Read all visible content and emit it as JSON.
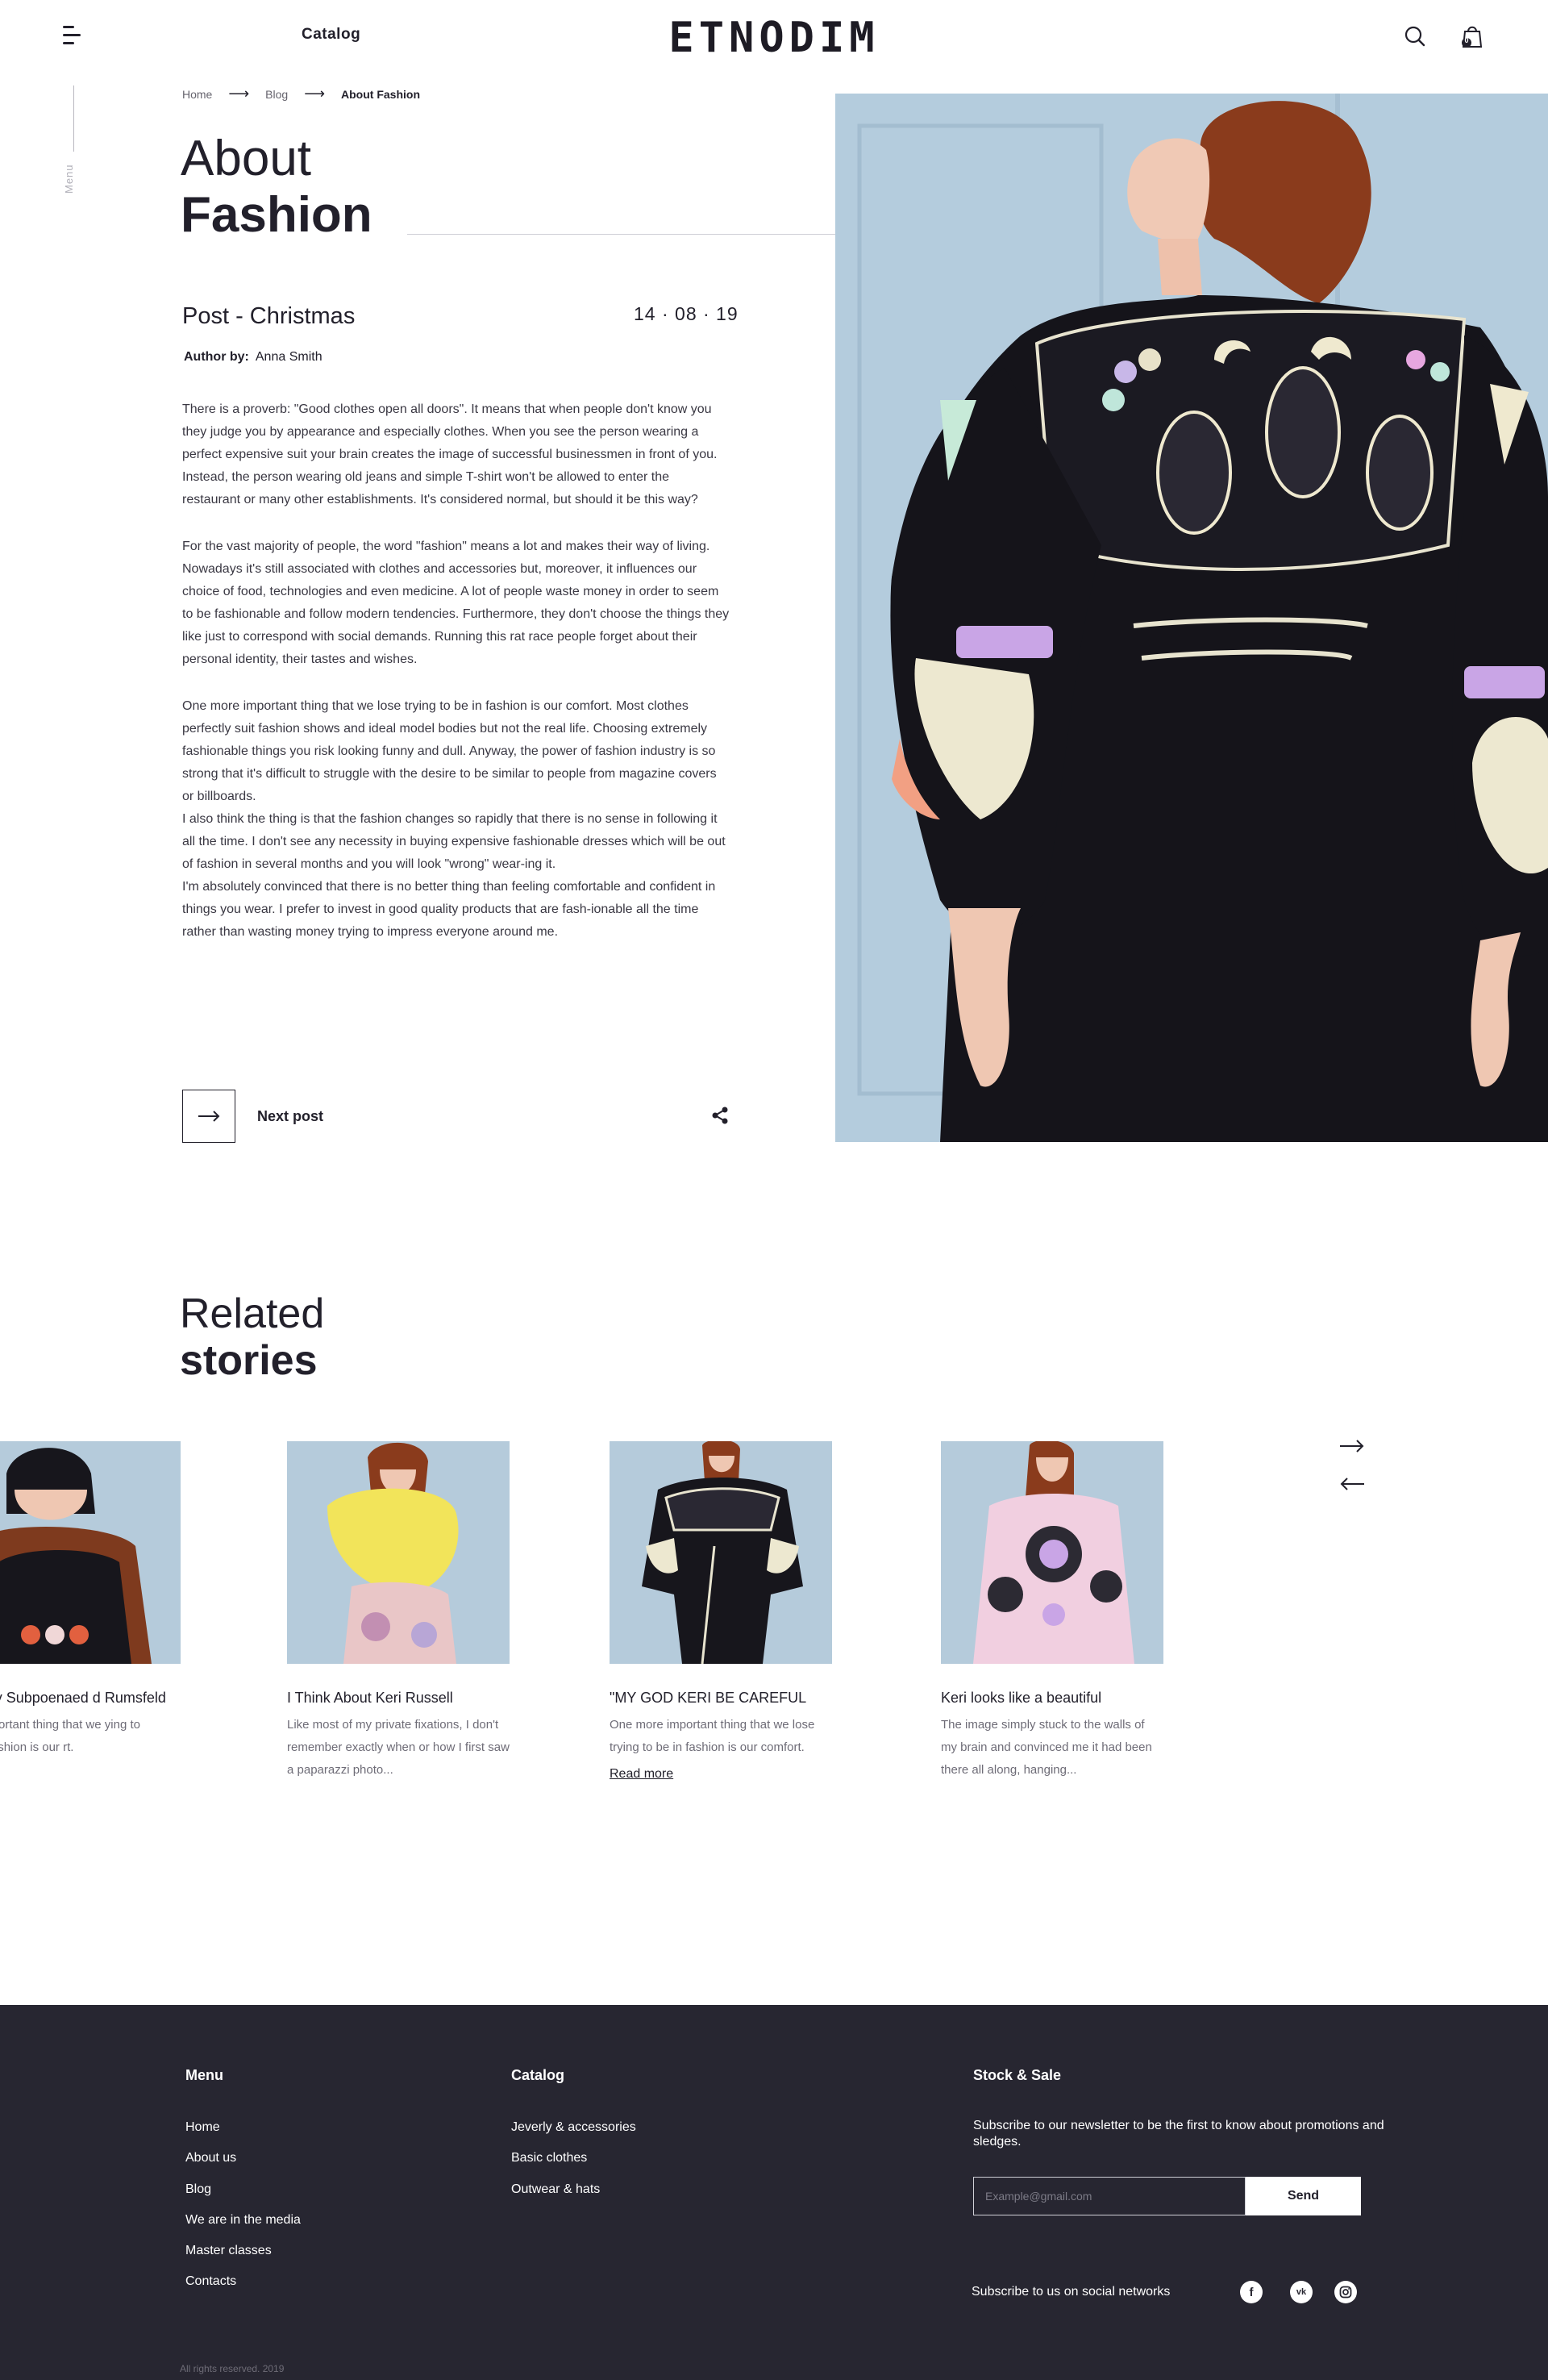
{
  "header": {
    "catalog_label": "Catalog",
    "logo_text": "ETNODIM",
    "cart_count": "0"
  },
  "side": {
    "menu_label": "Menu"
  },
  "breadcrumb": [
    "Home",
    "Blog",
    "About Fashion"
  ],
  "article": {
    "title_line1": "About",
    "title_line2": "Fashion",
    "post_tag": "Post - Christmas",
    "date": "14 · 08 · 19",
    "author_label": "Author by:",
    "author_name": "Anna Smith",
    "paragraphs": [
      "There is a proverb: \"Good clothes open all doors\". It means that when people don't know you they judge you by appearance and especially clothes. When you see the person wearing a perfect expensive suit your brain creates the image of successful businessmen in front of you. Instead, the person wearing old jeans and simple T-shirt won't be allowed to enter the restaurant or many other establishments. It's considered normal, but should it be this way?",
      "For the vast majority of people, the word \"fashion\" means a lot and makes their way of living. Nowadays it's still associated with clothes and accessories but, moreover, it influences our choice of food, technologies and even medicine. A lot of people waste money in order to seem to be fashionable and follow modern tendencies. Furthermore, they don't choose the things they like just to correspond with social demands. Running this rat race people forget about their personal identity, their tastes and wishes.",
      "One more important thing that we lose trying to be in fashion is our comfort. Most clothes perfectly suit fashion shows and ideal model bodies but not the real life. Choosing extremely fashionable things you risk looking funny and dull. Anyway, the power of fashion industry is so strong that it's difficult to struggle with the desire to be similar to people from magazine covers or billboards.",
      "I also think the thing is that the fashion changes so rapidly that there is no sense in following it all the time. I don't see any necessity in buying expensive fashionable dresses which will be out of fashion in several months and you will look \"wrong\" wear-ing it.",
      "I'm absolutely convinced that there is no better thing than feeling comfortable and confident in things you wear. I prefer to invest in good quality products that are fash-ionable all the time rather than wasting money trying to impress everyone around me."
    ],
    "next_post_label": "Next post"
  },
  "related": {
    "title_line1": "Related",
    "title_line2": "stories",
    "stories": [
      {
        "title": "e They Subpoenaed d Rumsfeld",
        "excerpt": "ore important thing that we ying to be in fashion is our rt.",
        "read_more": ""
      },
      {
        "title": "I Think About Keri Russell",
        "excerpt": "Like most of my private fixations, I don't remember exactly when or how I first saw a paparazzi photo...",
        "read_more": ""
      },
      {
        "title": "\"MY GOD KERI BE CAREFUL",
        "excerpt": "One more important thing that we lose trying to be in fashion is our comfort.",
        "read_more": "Read more"
      },
      {
        "title": "Keri looks like a beautiful",
        "excerpt": "The image simply stuck to the walls of my brain and convinced me it had been there all along, hanging...",
        "read_more": ""
      }
    ]
  },
  "footer": {
    "menu_title": "Menu",
    "menu_items": [
      "Home",
      "About us",
      "Blog",
      "We are in the media",
      "Master classes",
      "Contacts"
    ],
    "catalog_title": "Catalog",
    "catalog_items": [
      "Jeverly & accessories",
      "Basic clothes",
      "Outwear & hats"
    ],
    "stock_title": "Stock & Sale",
    "newsletter_text": "Subscribe to our newsletter to be the first to know about promotions and sledges.",
    "email_placeholder": "Example@gmail.com",
    "send_label": "Send",
    "social_label": "Subscribe to us on social networks",
    "social_icons": [
      "facebook-icon",
      "vk-icon",
      "instagram-icon"
    ],
    "copyright": "All rights reserved. 2019"
  },
  "colors": {
    "text_dark": "#22202b",
    "footer_bg": "#272631",
    "photo_bg": "#b4ccdd",
    "dress": "#15141a"
  }
}
